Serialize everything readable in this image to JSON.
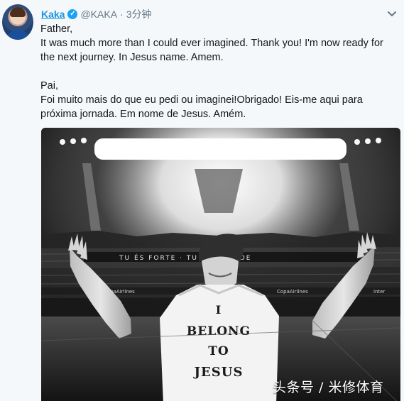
{
  "tweet": {
    "display_name": "Kaka",
    "verified_label": "✓",
    "handle": "@KAKA",
    "separator": "·",
    "time": "3分钟",
    "text": "Father,\nIt was much more than I could ever imagined. Thank you! I'm now ready for the next journey. In Jesus name. Amem.\n\nPai,\nFoi muito mais do que eu pedi ou imaginei!Obrigado! Eis-me aqui para próxima jornada. Em nome de Jesus. Amém.",
    "media": {
      "banner_text": "TU ÉS FORTE · TU ÉS GRANDE",
      "ad_left": "CopaAirlines",
      "ad_mid": "CopaAirlines",
      "ad_right": "inter",
      "shirt_line1": "I",
      "shirt_line2": "BELONG",
      "shirt_line3": "TO",
      "shirt_line4": "JESUS"
    },
    "watermark": "头条号 / 米修体育"
  },
  "icons": {
    "menu": "chevron-down-icon",
    "verified": "verified-badge-icon"
  },
  "colors": {
    "link": "#1b95e0",
    "verified": "#1da1f2",
    "secondary_text": "#657786",
    "text": "#14171a",
    "background": "#f5f8fa"
  }
}
